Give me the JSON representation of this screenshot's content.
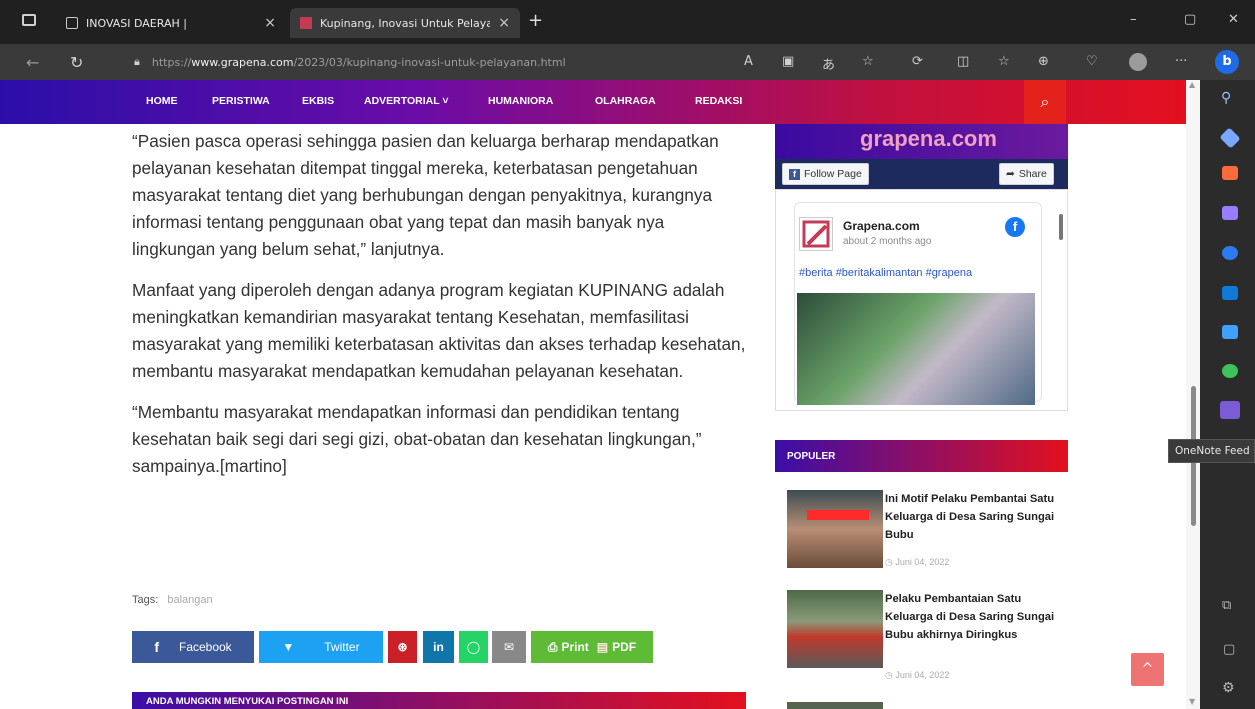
{
  "browser": {
    "tabs": [
      {
        "title": "INOVASI DAERAH |",
        "close": "×"
      },
      {
        "title": "Kupinang, Inovasi Untuk Pelayan",
        "close": "×"
      }
    ],
    "new_tab": "+",
    "window_controls": {
      "minimize": "–",
      "maximize": "▢",
      "close": "✕"
    },
    "url": {
      "scheme": "https://",
      "host": "www.grapena.com",
      "path": "/2023/03/kupinang-inovasi-untuk-pelayanan.html"
    },
    "toolbar_icons": [
      "read-aloud-icon",
      "immersive-reader-icon",
      "translate-icon",
      "favorite-star-icon",
      "extensions-icon",
      "split-screen-icon",
      "favorites-icon",
      "collections-icon",
      "performance-icon",
      "profile-icon",
      "more-icon",
      "bing-icon"
    ],
    "more_label": "···",
    "bing_label": "b"
  },
  "site_nav": {
    "items": [
      "HOME",
      "PERISTIWA",
      "EKBIS",
      "ADVERTORIAL ˅",
      "HUMANIORA",
      "OLAHRAGA",
      "REDAKSI"
    ],
    "search_glyph": "⌕"
  },
  "article": {
    "paragraphs": [
      "“Pasien pasca operasi sehingga pasien dan keluarga berharap mendapatkan pelayanan kesehatan ditempat tinggal mereka, keterbatasan pengetahuan masyarakat tentang diet yang berhubungan dengan penyakitnya, kurangnya informasi tentang penggunaan obat yang tepat dan masih banyak nya lingkungan yang belum sehat,” lanjutnya.",
      "Manfaat yang diperoleh dengan adanya program kegiatan KUPINANG adalah meningkatkan kemandirian masyarakat tentang Kesehatan, memfasilitasi masyarakat yang memiliki keterbatasan aktivitas dan akses terhadap kesehatan, membantu masyarakat mendapatkan kemudahan pelayanan kesehatan.",
      "“Membantu masyarakat mendapatkan informasi dan pendidikan tentang kesehatan baik segi dari segi gizi, obat-obatan dan kesehatan lingkungan,” sampainya.[martino]"
    ],
    "tags_label": "Tags:",
    "tag": "balangan",
    "share": {
      "facebook": "Facebook",
      "twitter": "Twitter",
      "print": "Print",
      "pdf": "PDF"
    },
    "related_heading": "ANDA MUNGKIN MENYUKAI POSTINGAN INI"
  },
  "sidebar": {
    "fb_widget": {
      "banner_text": "grapena.com",
      "follow_label": "Follow Page",
      "share_label": "Share",
      "page_name": "Grapena.com",
      "time": "about 2 months ago",
      "hashtags": "#berita #beritakalimantan #grapena"
    },
    "popular_heading": "POPULER",
    "popular_posts": [
      {
        "title": "Ini Motif Pelaku Pembantai Satu Keluarga di Desa Saring Sungai Bubu",
        "date": "Juni 04, 2022"
      },
      {
        "title": "Pelaku Pembantaian Satu Keluarga di Desa Saring Sungai Bubu akhirnya Diringkus",
        "date": "Juni 04, 2022"
      }
    ],
    "back_to_top": "^"
  },
  "edge_sidebar": {
    "tooltip": "OneNote Feed",
    "colors": [
      "#6aa6ff",
      "#3d8bff",
      "#ff6a3d",
      "#8a6cff",
      "#2d7bf0",
      "#0f7ad8",
      "#3fa0ff",
      "#3ec25a",
      "#7b5cd6"
    ]
  }
}
